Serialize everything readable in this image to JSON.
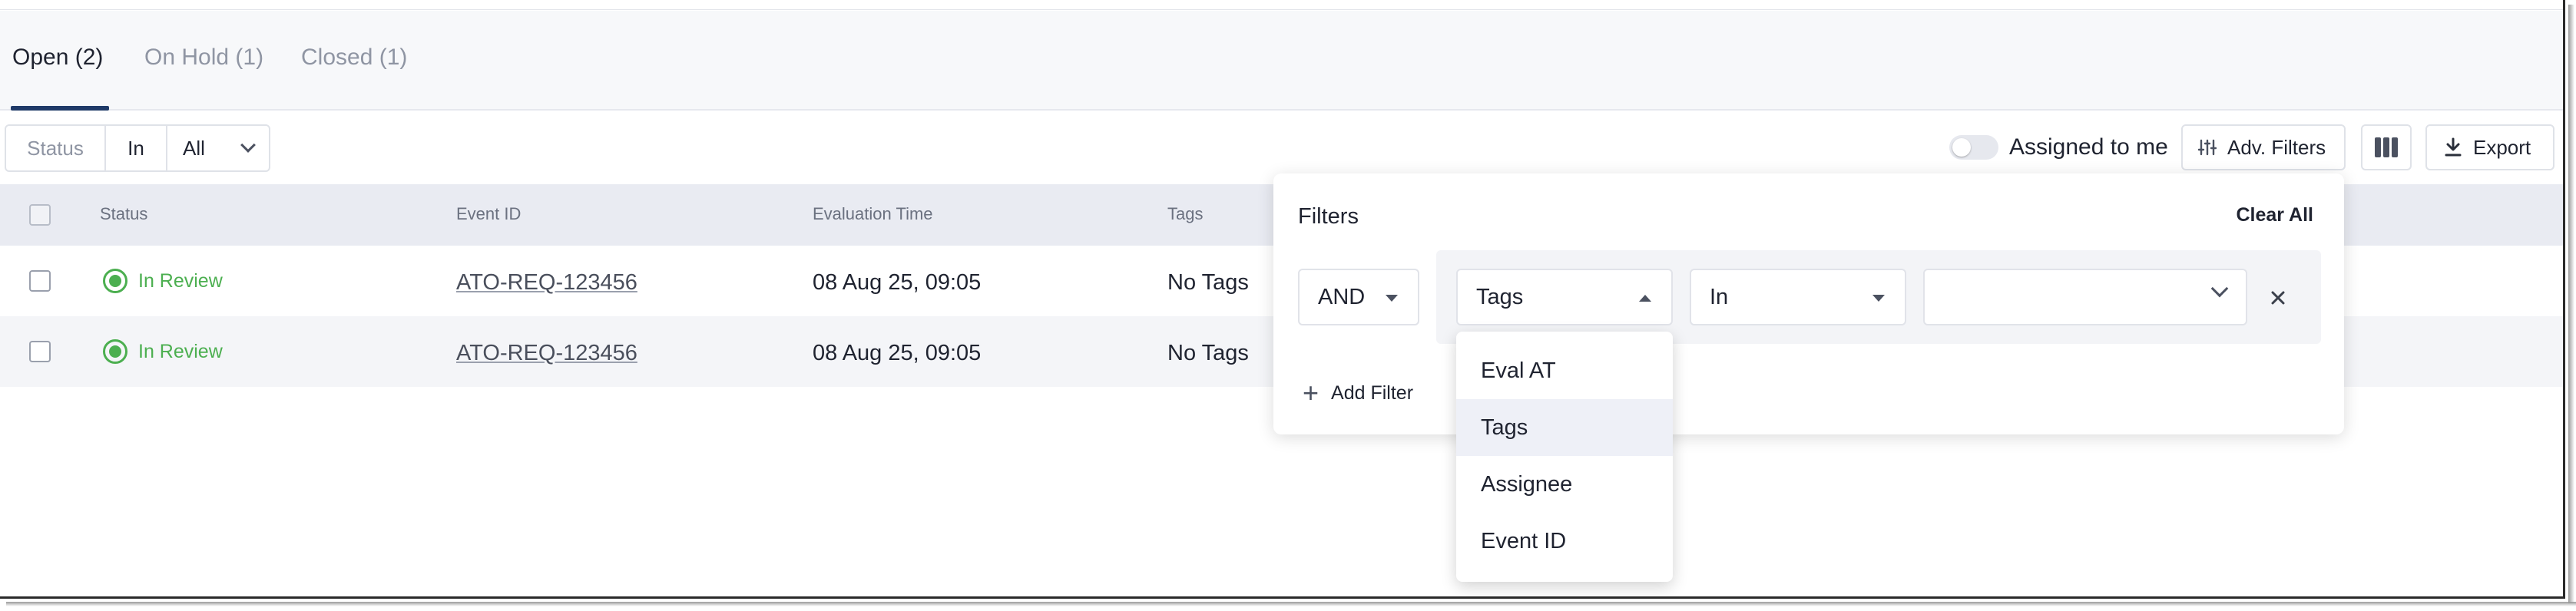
{
  "tabs": [
    {
      "label": "Open (2)",
      "active": true
    },
    {
      "label": "On Hold (1)",
      "active": false
    },
    {
      "label": "Closed (1)",
      "active": false
    }
  ],
  "status_filter": {
    "field": "Status",
    "operator": "In",
    "value": "All"
  },
  "toolbar": {
    "assigned_label": "Assigned to me",
    "assigned_on": false,
    "adv_filters_label": "Adv. Filters",
    "export_label": "Export"
  },
  "table": {
    "columns": [
      "Status",
      "Event ID",
      "Evaluation Time",
      "Tags"
    ],
    "rows": [
      {
        "status": "In Review",
        "event_id": "ATO-REQ-123456",
        "eval_time": "08 Aug 25, 09:05",
        "tags": "No Tags"
      },
      {
        "status": "In Review",
        "event_id": "ATO-REQ-123456",
        "eval_time": "08 Aug 25, 09:05",
        "tags": "No Tags"
      }
    ]
  },
  "filters_panel": {
    "title": "Filters",
    "clear_all": "Clear All",
    "conjunction": "AND",
    "field": "Tags",
    "operator": "In",
    "value": "",
    "add_filter": "Add Filter",
    "field_options": [
      "Eval AT",
      "Tags",
      "Assignee",
      "Event ID"
    ],
    "selected_option": "Tags"
  },
  "colors": {
    "accent": "#1f3a68",
    "status_green": "#4caf50",
    "header_bg": "#e9ebf2"
  }
}
